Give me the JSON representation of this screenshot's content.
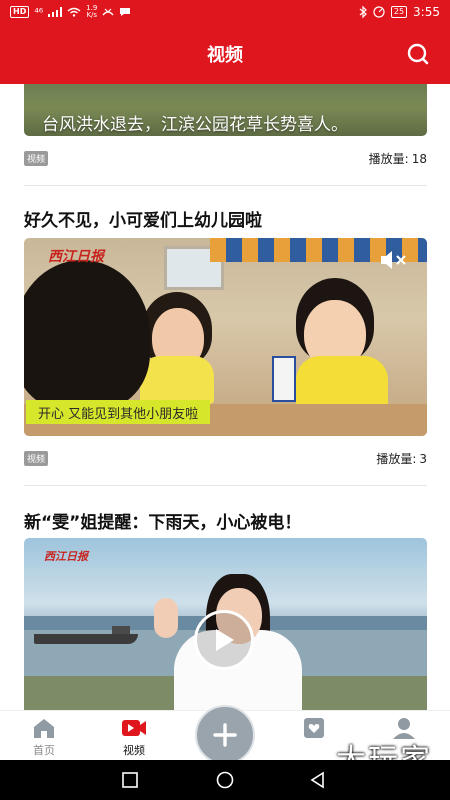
{
  "status_bar": {
    "hd_badge": "HD",
    "network": "⁴⁶",
    "speed_value": "1.9",
    "speed_unit": "K/s",
    "battery": "25",
    "time": "3:55"
  },
  "header": {
    "title": "视频",
    "search_icon": "search-icon"
  },
  "feed": {
    "items": [
      {
        "title": "",
        "caption": "台风洪水退去，江滨公园花草长势喜人。",
        "tag": "视频",
        "plays_label": "播放量:",
        "plays_value": "18"
      },
      {
        "title": "好久不见，小可爱们上幼儿园啦",
        "brand": "西江日报",
        "subtitle": "开心 又能见到其他小朋友啦",
        "mute_icon": "volume-muted-icon",
        "tag": "视频",
        "plays_label": "播放量:",
        "plays_value": "3"
      },
      {
        "title": "新“雯”姐提醒：下雨天，小心被电！",
        "brand": "西江日报",
        "play_icon": "play-icon"
      }
    ]
  },
  "tab_bar": {
    "tabs": [
      {
        "label": "首页",
        "icon": "home-icon",
        "active": false
      },
      {
        "label": "视频",
        "icon": "video-camera-icon",
        "active": true
      },
      {
        "label": "",
        "icon": "heart-card-icon",
        "active": false
      },
      {
        "label": "",
        "icon": "profile-icon",
        "active": false
      }
    ],
    "publish_icon": "plus-icon"
  },
  "watermark": "大玩家",
  "nav_bar": {
    "buttons": [
      "recent-apps-icon",
      "home-circle-icon",
      "back-triangle-icon"
    ]
  },
  "colors": {
    "brand_red": "#e0161e",
    "tag_gray": "#9a9a9a",
    "subtitle_yellow": "#d6e62b"
  }
}
